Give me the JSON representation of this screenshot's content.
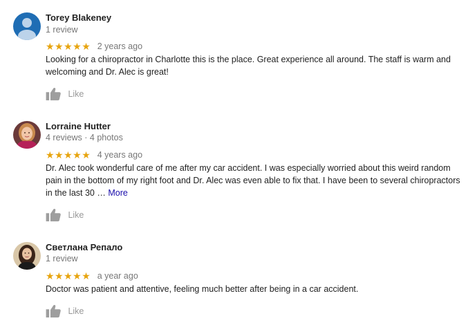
{
  "reviews": [
    {
      "author": "Torey Blakeney",
      "meta": "1 review",
      "stars": "★★★★★",
      "rating": 5,
      "date": "2 years ago",
      "text": "Looking for a chiropractor in Charlotte this is the place. Great experience all around. The staff is warm and welcoming and Dr. Alec is great!",
      "like_label": "Like",
      "avatar_icon": "default-person-avatar"
    },
    {
      "author": "Lorraine Hutter",
      "meta": "4 reviews · 4 photos",
      "stars": "★★★★★",
      "rating": 5,
      "date": "4 years ago",
      "text": "Dr. Alec took wonderful care of me after my car accident.  I was especially worried about this weird random pain in the bottom of my right foot and Dr. Alec was even able to fix that. I have been to several chiropractors in the last 30",
      "ellipsis": "…",
      "more_label": "More",
      "like_label": "Like",
      "avatar_icon": "profile-photo"
    },
    {
      "author": "Светлана Репало",
      "meta": "1 review",
      "stars": "★★★★★",
      "rating": 5,
      "date": "a year ago",
      "text": "Doctor was patient and attentive, feeling much better after being in a car accident.",
      "like_label": "Like",
      "avatar_icon": "profile-photo"
    }
  ],
  "colors": {
    "star": "#e7a40e",
    "link": "#1a0dab",
    "secondary_text": "#777777",
    "like_text": "#999999",
    "default_avatar_bg": "#1f6db4"
  }
}
